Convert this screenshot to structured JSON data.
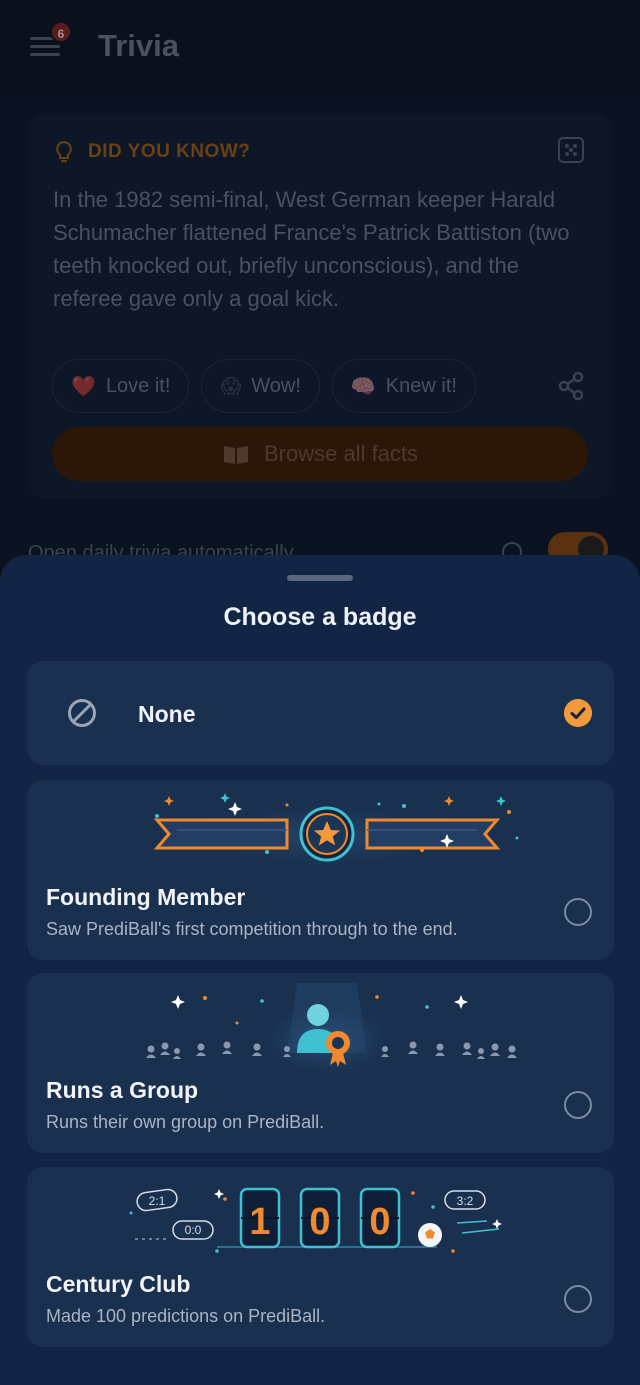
{
  "header": {
    "title": "Trivia",
    "notification_count": "6"
  },
  "fact": {
    "heading": "DID YOU KNOW?",
    "body": "In the 1982 semi-final, West German keeper Harald Schumacher flattened France's Patrick Battiston (two teeth knocked out, briefly unconscious), and the referee gave only a goal kick.",
    "reactions": [
      {
        "emoji": "❤️",
        "label": "Love it!"
      },
      {
        "emoji": "😱",
        "label": "Wow!"
      },
      {
        "emoji": "🧠",
        "label": "Knew it!"
      }
    ],
    "browse_label": "Browse all facts"
  },
  "settings": {
    "auto_open_label": "Open daily trivia automatically",
    "auto_open_enabled": true
  },
  "sheet": {
    "title": "Choose a badge",
    "none_label": "None",
    "selected": "None",
    "badges": [
      {
        "name": "Founding Member",
        "description": "Saw PrediBall's first competition through to the end."
      },
      {
        "name": "Runs a Group",
        "description": "Runs their own group on PrediBall."
      },
      {
        "name": "Century Club",
        "description": "Made 100 predictions on PrediBall."
      }
    ],
    "century_art": {
      "digits": [
        "1",
        "0",
        "0"
      ],
      "scores": [
        "2:1",
        "0:0",
        "3:2"
      ]
    }
  },
  "colors": {
    "accent": "#f49a3c",
    "sheet_bg": "#132544",
    "card_bg": "#19304f",
    "teal": "#3fc1d1"
  }
}
